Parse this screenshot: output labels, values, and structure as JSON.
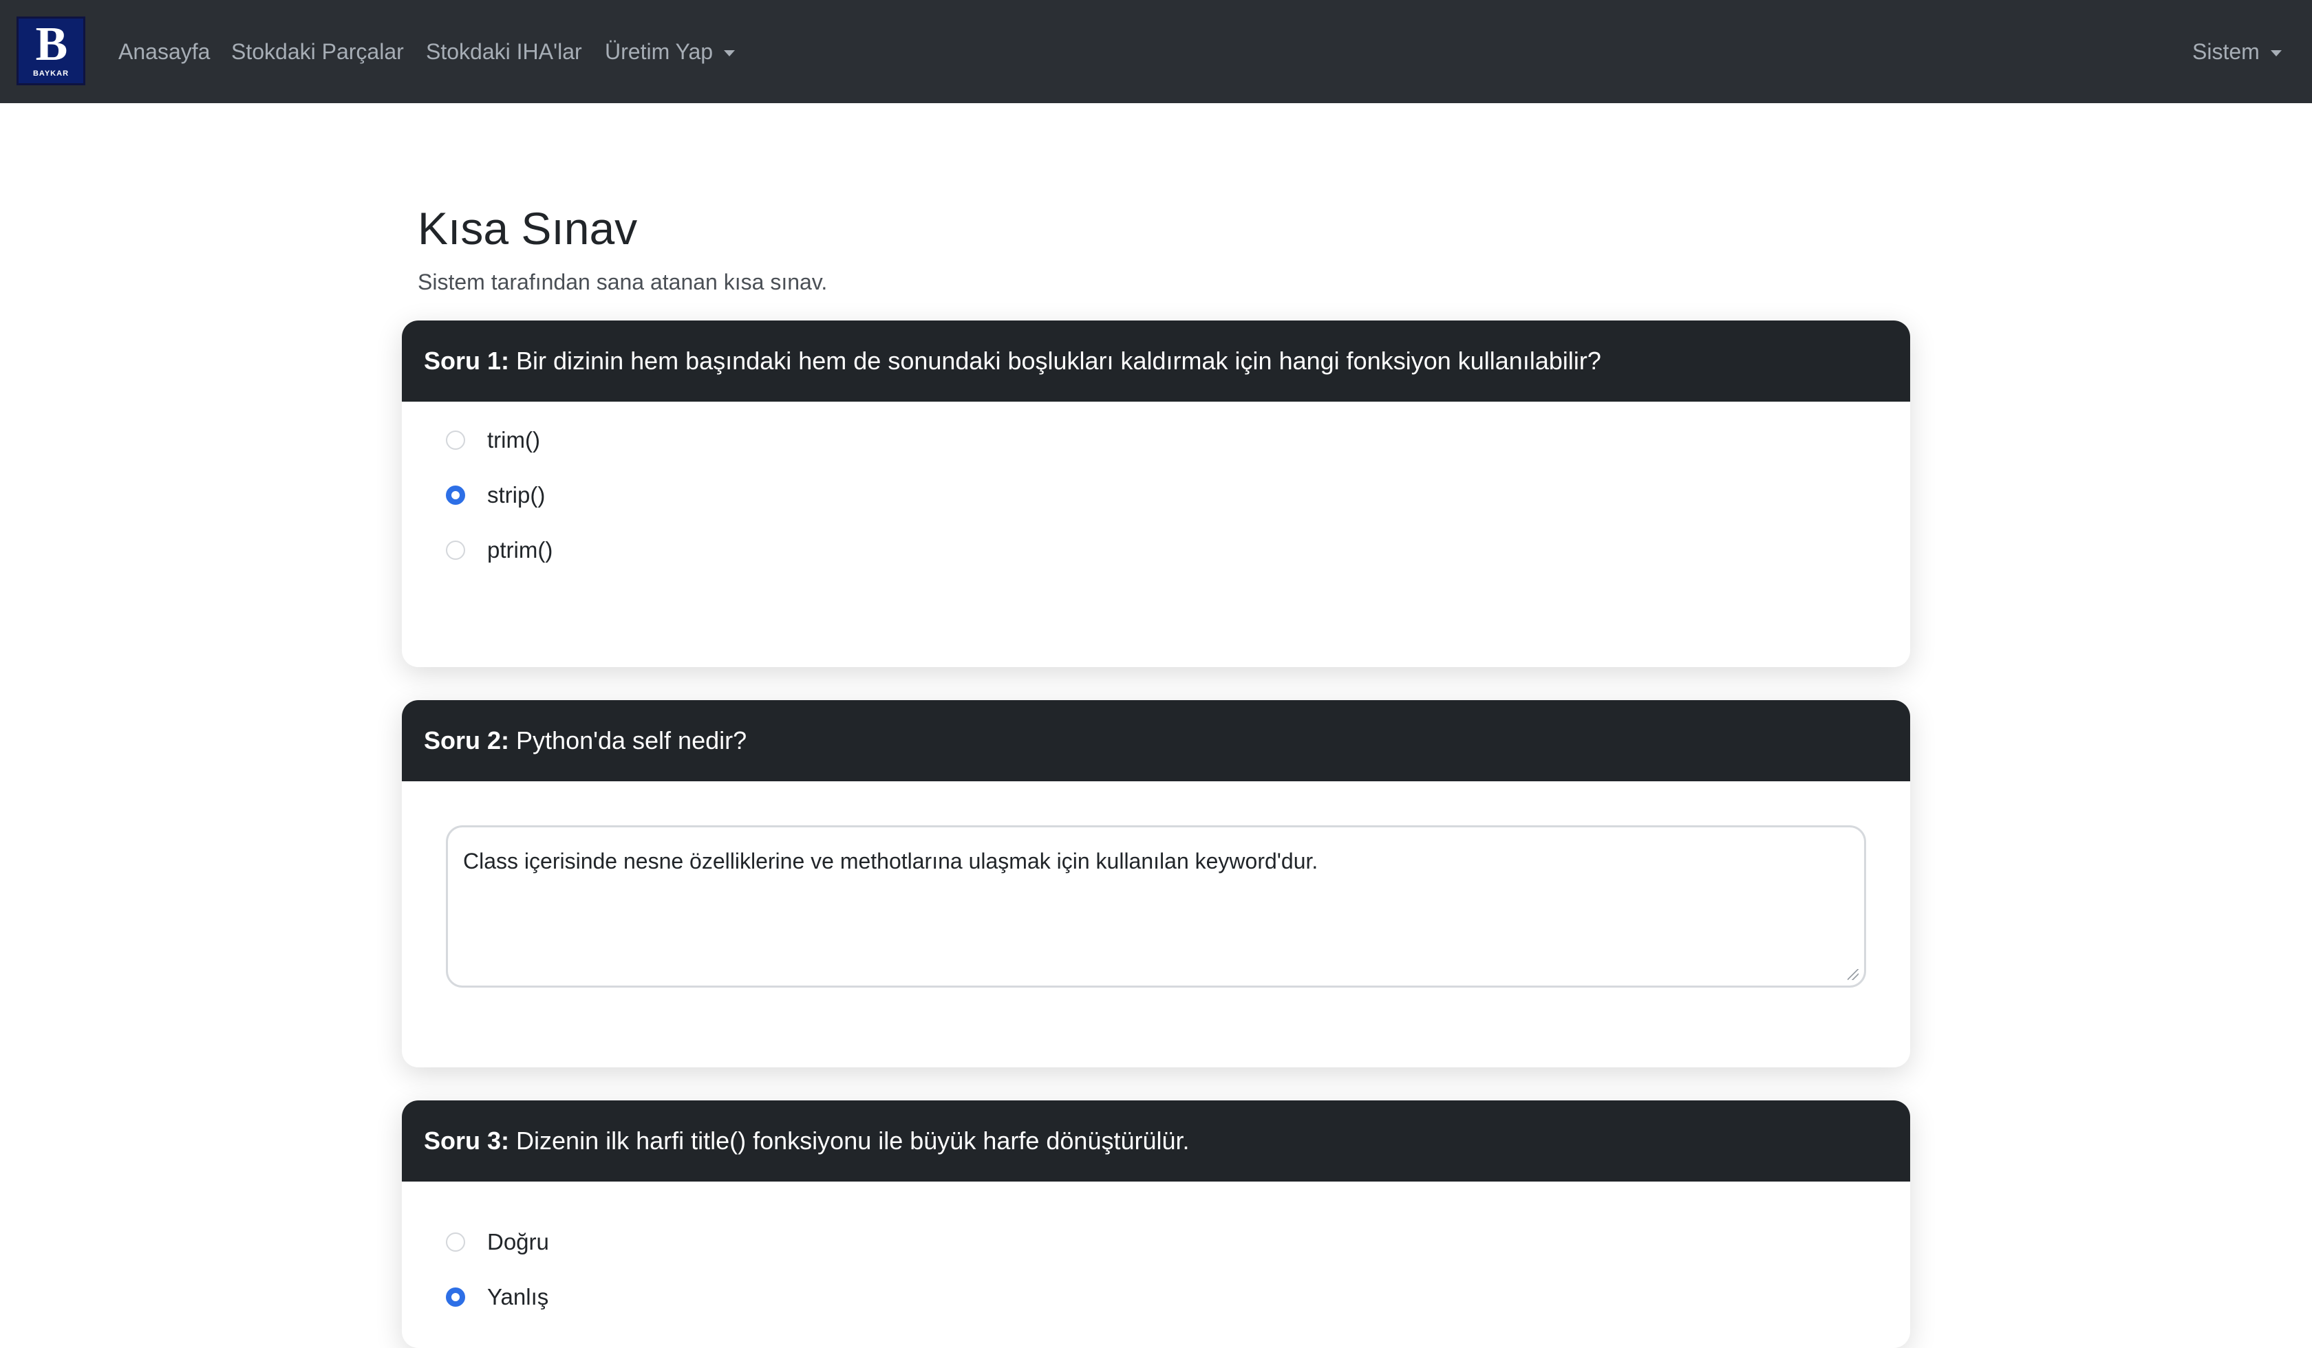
{
  "navbar": {
    "brand_text": "BAYKAR",
    "links": [
      "Anasayfa",
      "Stokdaki Parçalar",
      "Stokdaki IHA'lar"
    ],
    "dropdown_label": "Üretim Yap",
    "right_dropdown_label": "Sistem"
  },
  "header": {
    "title": "Kısa Sınav",
    "subtitle": "Sistem tarafından sana atanan kısa sınav."
  },
  "questions": [
    {
      "label": "Soru 1:",
      "text": "Bir dizinin hem başındaki hem de sonundaki boşlukları kaldırmak için hangi fonksiyon kullanılabilir?",
      "options": [
        "trim()",
        "strip()",
        "ptrim()"
      ],
      "selected": "strip()"
    },
    {
      "label": "Soru 2:",
      "text": "Python'da self nedir?",
      "answer": "Class içerisinde nesne özelliklerine ve methotlarına ulaşmak için kullanılan keyword'dur."
    },
    {
      "label": "Soru 3:",
      "text": "Dizenin ilk harfi title() fonksiyonu ile büyük harfe dönüştürülür.",
      "options": [
        "Doğru",
        "Yanlış"
      ],
      "selected": "Yanlış"
    }
  ],
  "colors": {
    "navbar_bg": "#2b2f34",
    "card_header_bg": "#212529",
    "accent": "#2d6fe6",
    "brand_bg": "#0b1f6b"
  }
}
